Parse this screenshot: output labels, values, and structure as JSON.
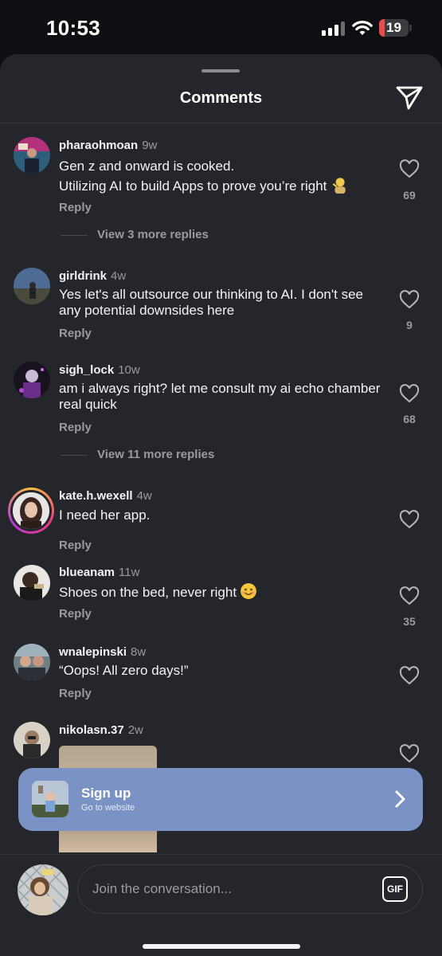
{
  "status_bar": {
    "time": "10:53",
    "battery": "19",
    "battery_level": 0.19
  },
  "header": {
    "title": "Comments"
  },
  "comments": [
    {
      "username": "pharaohmoan",
      "time": "9w",
      "text": "Gen z and onward is cooked.\nUtilizing AI to build Apps to prove you’re right",
      "reply": "Reply",
      "likes": "69",
      "view_more": "View 3 more replies"
    },
    {
      "username": "girldrink",
      "time": "4w",
      "text": "Yes let's all outsource our thinking to AI. I don't see any potential downsides here",
      "reply": "Reply",
      "likes": "9"
    },
    {
      "username": "sigh_lock",
      "time": "10w",
      "text": "am i always right? let me consult my ai echo chamber real quick",
      "reply": "Reply",
      "likes": "68",
      "view_more": "View 11 more replies"
    },
    {
      "username": "kate.h.wexell",
      "time": "4w",
      "text": "I need her app.",
      "reply": "Reply"
    },
    {
      "username": "blueanam",
      "time": "11w",
      "text": "Shoes on the bed, never right",
      "reply": "Reply",
      "likes": "35"
    },
    {
      "username": "wnalepinski",
      "time": "8w",
      "text": "“Oops! All zero days!”",
      "reply": "Reply"
    },
    {
      "username": "nikolasn.37",
      "time": "2w"
    }
  ],
  "banner": {
    "title": "Sign up",
    "subtitle": "Go to website"
  },
  "composer": {
    "placeholder": "Join the conversation...",
    "gif_label": "GIF"
  },
  "colors": {
    "sheet_bg": "#25262b",
    "banner_bg": "#7a93c4",
    "battery_red": "#eb4b4b"
  }
}
